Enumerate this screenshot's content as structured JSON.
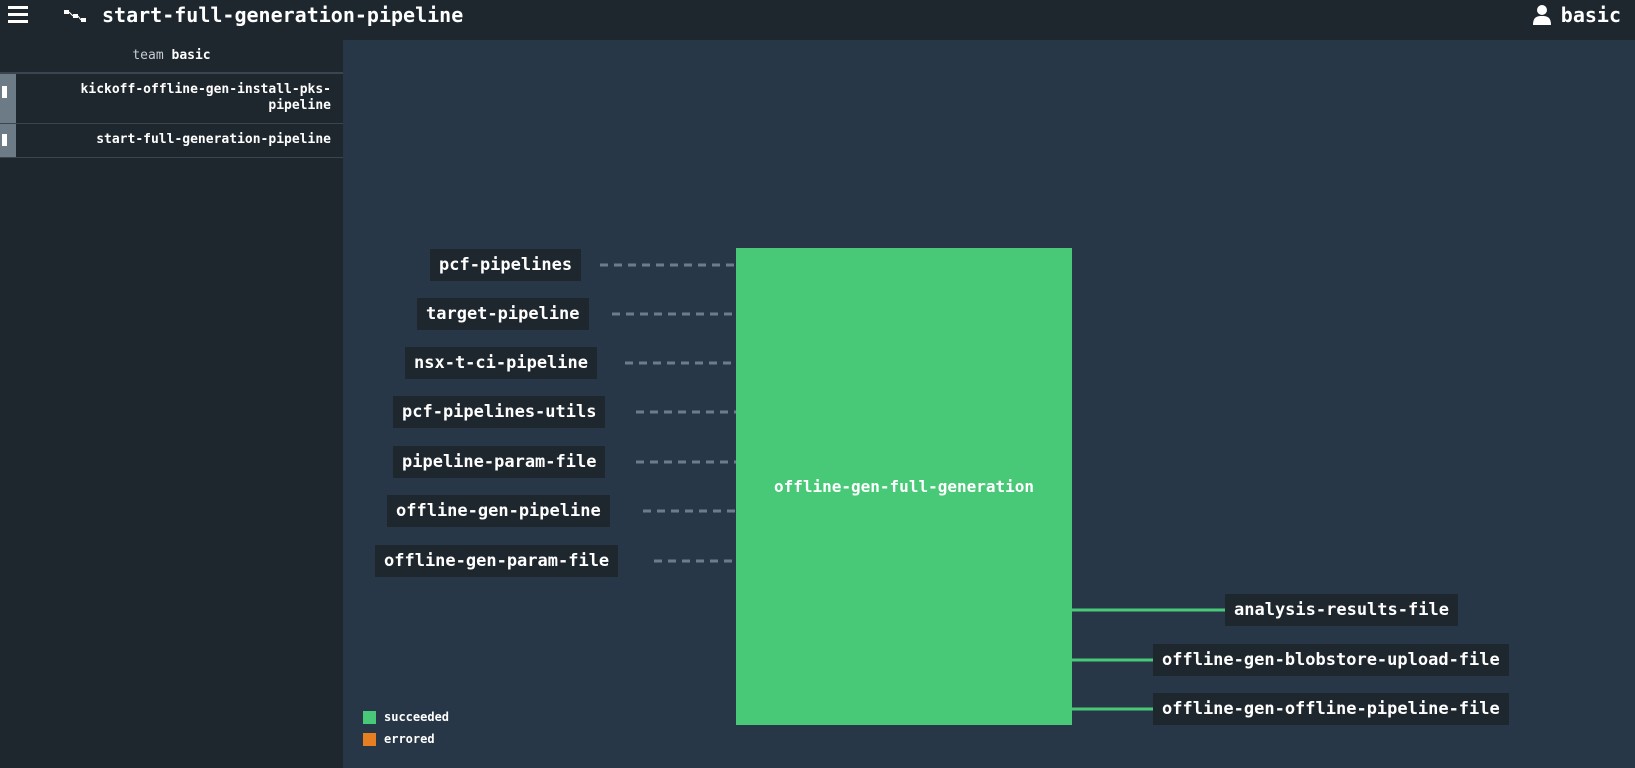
{
  "header": {
    "title": "start-full-generation-pipeline",
    "user": "basic"
  },
  "sidebar": {
    "team_prefix": "team",
    "team_name": "basic",
    "items": [
      {
        "label": "kickoff-offline-gen-install-pks-pipeline",
        "paused": true
      },
      {
        "label": "start-full-generation-pipeline",
        "paused": true
      }
    ]
  },
  "graph": {
    "inputs": [
      "pcf-pipelines",
      "target-pipeline",
      "nsx-t-ci-pipeline",
      "pcf-pipelines-utils",
      "pipeline-param-file",
      "offline-gen-pipeline",
      "offline-gen-param-file"
    ],
    "job": {
      "name": "offline-gen-full-generation",
      "status": "succeeded"
    },
    "outputs": [
      "analysis-results-file",
      "offline-gen-blobstore-upload-file",
      "offline-gen-offline-pipeline-file"
    ]
  },
  "legend": [
    {
      "label": "succeeded",
      "color": "#48c977"
    },
    {
      "label": "errored",
      "color": "#e67e22"
    }
  ],
  "colors": {
    "background": "#273747",
    "bar": "#1e262e",
    "succeeded": "#48c977",
    "dashed_line": "#6b7c8c"
  },
  "icons": {
    "menu": "hamburger-icon",
    "pipeline": "pipeline-icon",
    "user": "user-icon"
  }
}
